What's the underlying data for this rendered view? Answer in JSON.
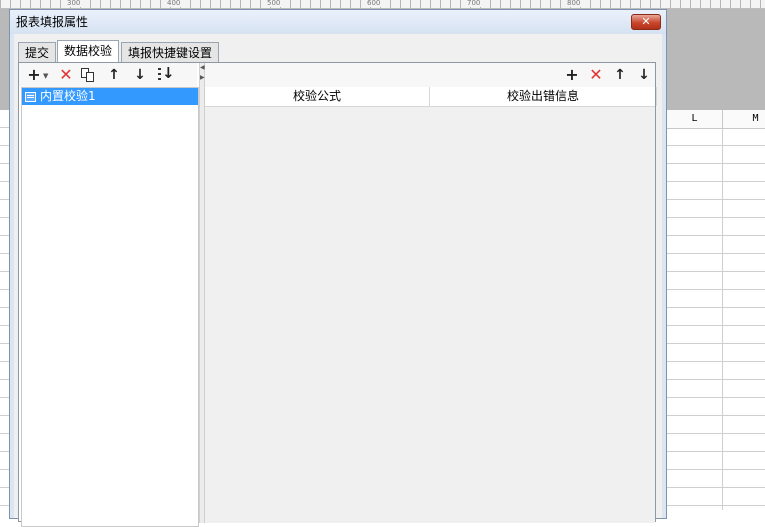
{
  "ruler": {
    "ticks": [
      "300",
      "400",
      "500",
      "600",
      "700",
      "800"
    ]
  },
  "spreadsheet": {
    "columns": [
      "L",
      "M"
    ]
  },
  "dialog": {
    "title": "报表填报属性",
    "close_glyph": "✕",
    "tabs": [
      {
        "label": "提交",
        "active": false
      },
      {
        "label": "数据校验",
        "active": true
      },
      {
        "label": "填报快捷键设置",
        "active": false
      }
    ],
    "left_toolbar": {
      "icons": [
        "add-dropdown-icon",
        "delete-icon",
        "copy-icon",
        "move-up-icon",
        "move-down-icon",
        "move-bottom-icon"
      ],
      "add_glyph": "+",
      "delete_glyph": "✕",
      "up_glyph": "↑",
      "down_glyph": "↓"
    },
    "validation_list": [
      {
        "label": "内置校验1",
        "selected": true
      }
    ],
    "right_toolbar": {
      "icons": [
        "add-icon",
        "delete-icon",
        "move-up-icon",
        "move-down-icon"
      ],
      "add_glyph": "+",
      "delete_glyph": "✕",
      "up_glyph": "↑",
      "down_glyph": "↓"
    },
    "grid": {
      "columns": [
        "校验公式",
        "校验出错信息"
      ]
    },
    "colors": {
      "selection": "#3399ff",
      "close_button": "#c9462c",
      "delete_icon": "#e53131",
      "title_bar": "#dce6f2"
    }
  }
}
